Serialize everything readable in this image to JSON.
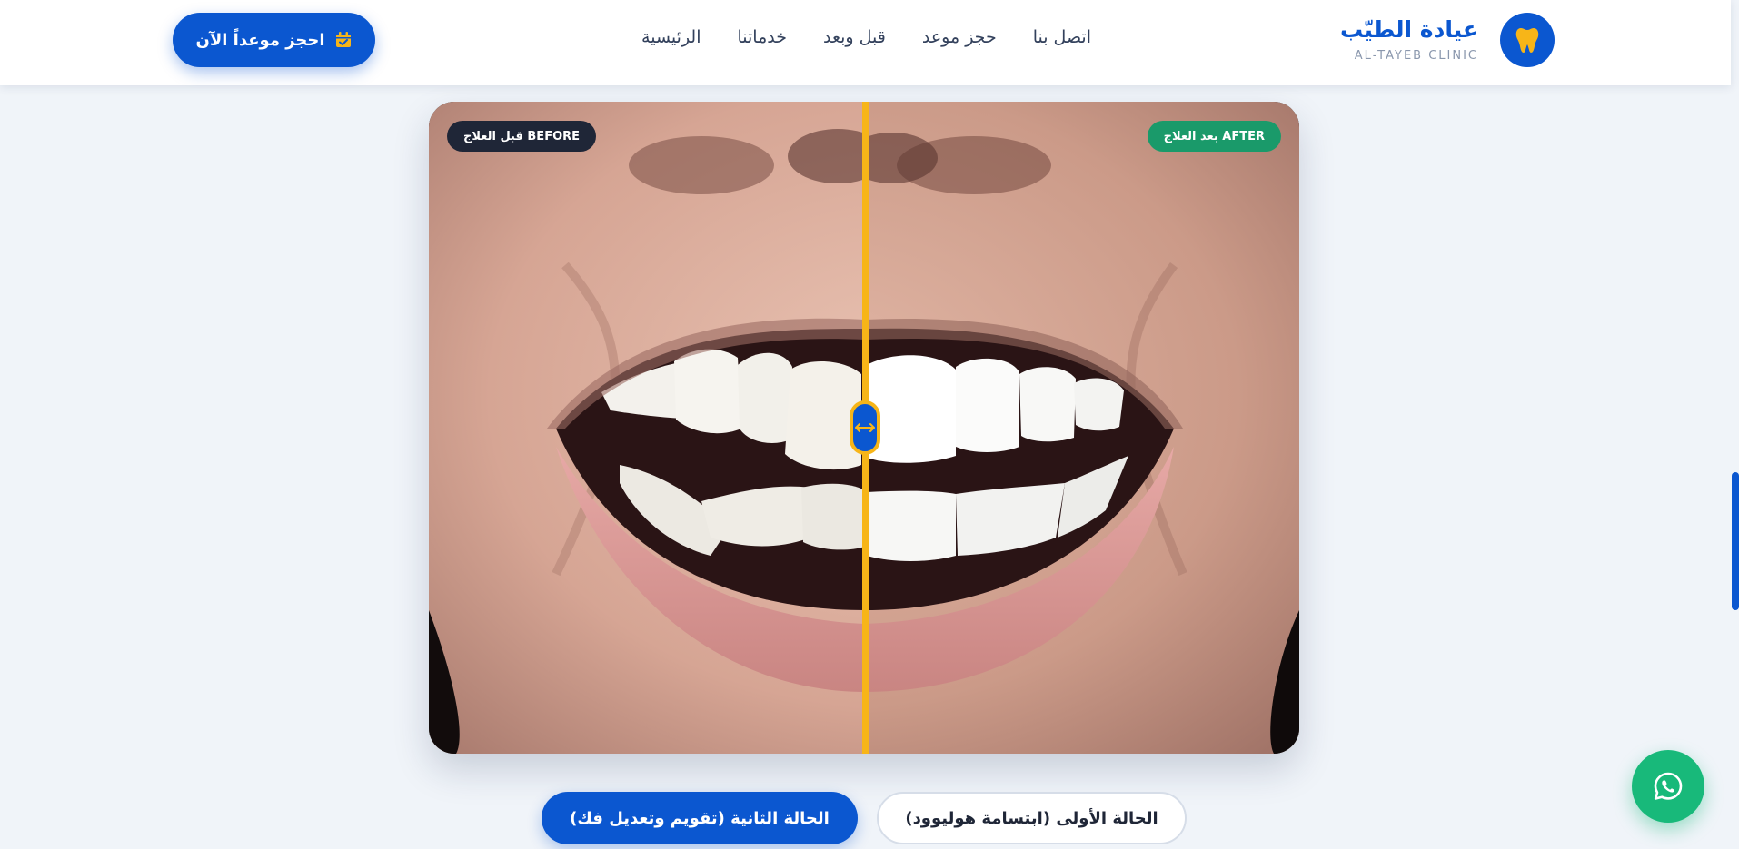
{
  "header": {
    "logo_title": "عيادة الطيّب",
    "logo_subtitle": "AL-TAYEB CLINIC",
    "nav": [
      "الرئيسية",
      "خدماتنا",
      "قبل وبعد",
      "حجز موعد",
      "اتصل بنا"
    ],
    "book_button": "احجز موعداً الآن"
  },
  "compare": {
    "before_label": "قبل العلاج BEFORE",
    "after_label": "بعد العلاج AFTER",
    "slider_position_percent": 50
  },
  "cases": {
    "case_1": "الحالة الأولى (ابتسامة هوليوود)",
    "case_2": "الحالة الثانية (تقويم وتعديل فك)"
  },
  "icons": {
    "logo": "tooth-icon",
    "book": "calendar-check-icon",
    "handle": "arrows-left-right-icon",
    "whatsapp": "whatsapp-icon"
  },
  "colors": {
    "brand": "#0b57d0",
    "accent": "#f7b518",
    "success": "#18b97a",
    "dark": "#1f2637"
  }
}
